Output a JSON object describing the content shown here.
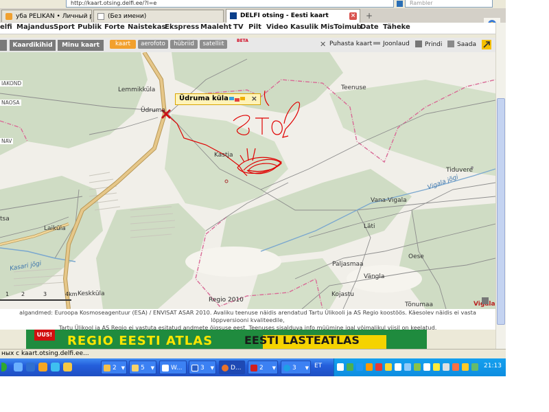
{
  "browser": {
    "address": "http://kaart.otsing.delfi.ee/?l=e",
    "search_placeholder": "Rambler",
    "tabs": [
      {
        "label": "уба PELIKAN • Личный разд..."
      },
      {
        "label": "(Без имени)"
      },
      {
        "label": "DELFI otsing - Eesti kaart"
      }
    ],
    "new_tab": "+",
    "close_tab": "×"
  },
  "site_nav": [
    "elfi",
    "Majandus",
    "Sport",
    "Publik",
    "Forte",
    "Naistekas",
    "Ekspress",
    "Maaleht",
    "TV",
    "Pilt",
    "Video",
    "Kasulik",
    "MisToimub",
    "Date",
    "Täheke"
  ],
  "map_toolbar": {
    "tabs": [
      "Kaardikihid",
      "Minu kaart"
    ],
    "modes": [
      "kaart",
      "aerofoto",
      "hübriid",
      "satelliit"
    ],
    "active_mode": "kaart",
    "beta": "BETA",
    "tools": [
      "Puhasta kaart",
      "Joonlaud",
      "Prindi",
      "Saada"
    ]
  },
  "map": {
    "places": [
      "Lemmikküla",
      "Üdruma",
      "Kastja",
      "Teenuse",
      "Tiduvere",
      "Vana-Vigala",
      "Läti",
      "Oese",
      "Paljasmaa",
      "Vängla",
      "Kojastu",
      "Tõnumaa",
      "Laiküla",
      "Keskküla",
      "Vigala"
    ],
    "rivers": [
      "Kasari jõgi",
      "Vigala jõgi"
    ],
    "edge_labels": [
      "IAKOND",
      "NAOSA",
      "NAV",
      "tsa"
    ],
    "popup_title": "Üdruma küla",
    "popup_close": "×",
    "drawing_text": "это?",
    "scale_ticks": [
      "1",
      "2",
      "3",
      "4km"
    ],
    "copyright": "Regio 2010",
    "colors": {
      "forest": "#cfdcc4",
      "open": "#f1efe9",
      "border": "#d96a96",
      "main_road": "#d9b474",
      "route": "#e00000"
    }
  },
  "attribution": [
    "algandmed: Euroopa Kosmoseagentuur (ESA) / ENVISAT ASAR 2010. Avaliku teenuse näidis arendatud Tartu Ülikooli ja AS Regio koostöös. Käesolev näidis ei vasta lõppversiooni kvaliteedile,",
    "Tartu Ülikool ja AS Regio ei vastuta esitatud andmete õigsuse eest. Teenuses sisalduva info müümine igal võimalikul viisil on keelatud."
  ],
  "banner": {
    "left": "REGIO EESTI ATLAS",
    "right": "EESTI LASTEATLAS",
    "badge": "UUS!"
  },
  "status_text": "ных с kaart.otsing.delfi.ee...",
  "taskbar": {
    "buttons": [
      {
        "label": "2"
      },
      {
        "label": "5"
      },
      {
        "label": "W..."
      },
      {
        "label": "3"
      },
      {
        "label": "D..."
      },
      {
        "label": "2"
      },
      {
        "label": "3"
      }
    ],
    "language": "ET",
    "clock": "21:13"
  }
}
